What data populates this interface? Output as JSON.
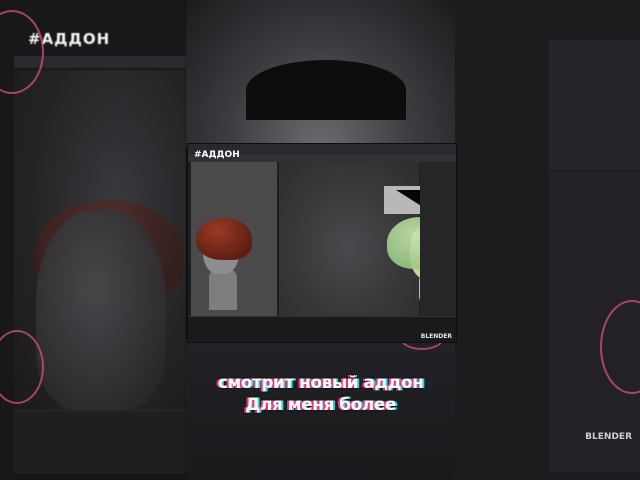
{
  "channel_tag": "#АДДОН",
  "inset": {
    "tag": "#АДДОН",
    "brand": "BLENDER"
  },
  "background": {
    "brand": "BLENDER"
  },
  "caption": {
    "line1": "смотрит новый аддон",
    "line2": "Для меня более"
  },
  "colors": {
    "accent_pink": "#d5527d",
    "glitch_red": "#ff2a6a",
    "glitch_cyan": "#27d8e8",
    "hair_red": "#9a3a26",
    "hair_green": "#98c982",
    "skin_tone": "#d7c79a"
  }
}
